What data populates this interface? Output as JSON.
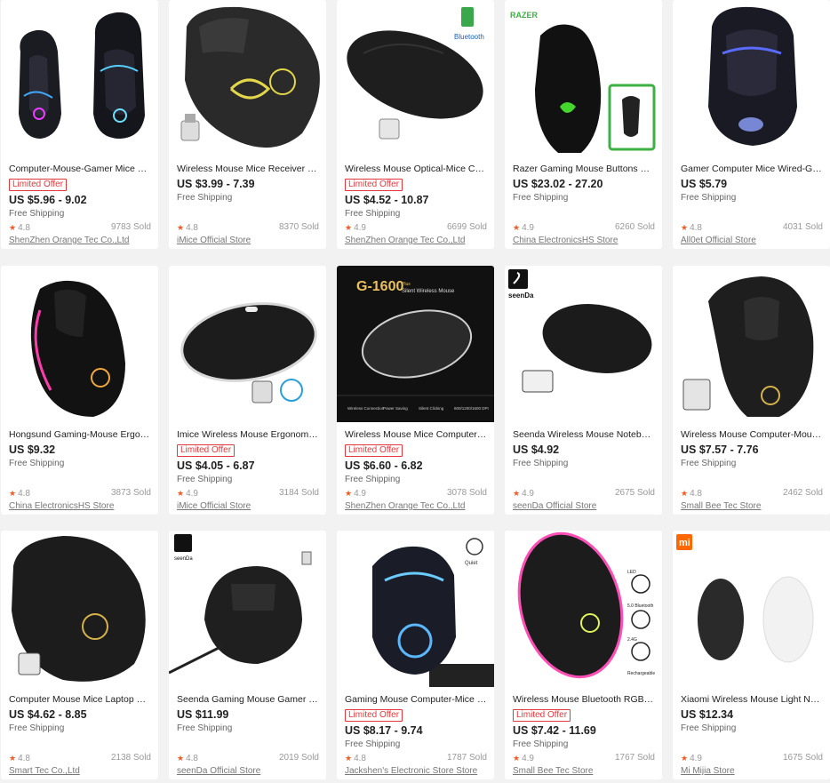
{
  "products": [
    {
      "title": "Computer-Mouse-Gamer Mice Ergonomic",
      "badge": "Limited Offer",
      "price": "US $5.96 - 9.02",
      "shipping": "Free Shipping",
      "rating": "4.8",
      "sold": "9783 Sold",
      "store": "ShenZhen Orange Tec Co.,Ltd",
      "image": "mouse-pair-rgb-icon"
    },
    {
      "title": "Wireless Mouse Mice Receiver Ergonomic",
      "badge": "",
      "price": "US $3.99 - 7.39",
      "shipping": "Free Shipping",
      "rating": "4.8",
      "sold": "8370 Sold",
      "store": "iMice Official Store",
      "image": "ergonomic-wireless-mouse-icon"
    },
    {
      "title": "Wireless Mouse Optical-Mice Computer",
      "badge": "Limited Offer",
      "price": "US $4.52 - 10.87",
      "shipping": "Free Shipping",
      "rating": "4.9",
      "sold": "6699 Sold",
      "store": "ShenZhen Orange Tec Co.,Ltd",
      "image": "slim-wireless-mouse-icon"
    },
    {
      "title": "Razer Gaming Mouse Buttons Mice",
      "badge": "",
      "price": "US $23.02 - 27.20",
      "shipping": "Free Shipping",
      "rating": "4.9",
      "sold": "6260 Sold",
      "store": "China ElectronicsHS Store",
      "image": "razer-mouse-icon"
    },
    {
      "title": "Gamer Computer Mice Wired-Gaming",
      "badge": "",
      "price": "US $5.79",
      "shipping": "Free Shipping",
      "rating": "4.8",
      "sold": "4031 Sold",
      "store": "All0et Official Store",
      "image": "gamer-mouse-icon"
    },
    {
      "title": "Hongsund Gaming-Mouse Ergonomic",
      "badge": "",
      "price": "US $9.32",
      "shipping": "Free Shipping",
      "rating": "4.8",
      "sold": "3873 Sold",
      "store": "China ElectronicsHS Store",
      "image": "gaming-mouse-rgb-icon"
    },
    {
      "title": "Imice Wireless Mouse Ergonomic Laptop",
      "badge": "Limited Offer",
      "price": "US $4.05 - 6.87",
      "shipping": "Free Shipping",
      "rating": "4.9",
      "sold": "3184 Sold",
      "store": "iMice Official Store",
      "image": "silent-wireless-mouse-icon"
    },
    {
      "title": "Wireless Mouse Mice Computer Laptop",
      "badge": "Limited Offer",
      "price": "US $6.60 - 6.82",
      "shipping": "Free Shipping",
      "rating": "4.9",
      "sold": "3078 Sold",
      "store": "ShenZhen Orange Tec Co.,Ltd",
      "image": "g1600-mouse-icon",
      "banner": "G-1600",
      "banner_sub": "Silent Wireless Mouse",
      "banner_plus": "Plus",
      "feat": [
        "Wireless Connection",
        "Power Saving",
        "Silent Clicking",
        "800/1200/1600 DPI"
      ]
    },
    {
      "title": "Seenda Wireless Mouse Notebook Mice",
      "badge": "",
      "price": "US $4.92",
      "shipping": "Free Shipping",
      "rating": "4.9",
      "sold": "2675 Sold",
      "store": "seenDa Official Store",
      "image": "seenda-mouse-icon",
      "brand": "seenDa"
    },
    {
      "title": "Wireless Mouse Computer-Mouse-Ergonomic",
      "badge": "",
      "price": "US $7.57 - 7.76",
      "shipping": "Free Shipping",
      "rating": "4.8",
      "sold": "2462 Sold",
      "store": "Small Bee Tec Store",
      "image": "vertical-mouse-icon"
    },
    {
      "title": "Computer Mouse Mice Laptop Ghz Wireless",
      "badge": "",
      "price": "US $4.62 - 8.85",
      "shipping": "Free Shipping",
      "rating": "4.8",
      "sold": "2138 Sold",
      "store": "Smart Tec Co.,Ltd",
      "image": "ergonomic-mouse-icon"
    },
    {
      "title": "Seenda Gaming Mouse Gamer Laptop",
      "badge": "",
      "price": "US $11.99",
      "shipping": "Free Shipping",
      "rating": "4.8",
      "sold": "2019 Sold",
      "store": "seenDa Official Store",
      "image": "seenda-gaming-mouse-icon",
      "brand": "seenDa"
    },
    {
      "title": "Gaming Mouse Computer-Mice Wired",
      "badge": "Limited Offer",
      "price": "US $8.17 - 9.74",
      "shipping": "Free Shipping",
      "rating": "4.8",
      "sold": "1787 Sold",
      "store": "Jackshen's Electronic Store Store",
      "image": "quiet-gaming-mouse-icon",
      "quiet": "Quiet"
    },
    {
      "title": "Wireless Mouse Bluetooth RGB Rechargeable",
      "badge": "Limited Offer",
      "price": "US $7.42 - 11.69",
      "shipping": "Free Shipping",
      "rating": "4.9",
      "sold": "1767 Sold",
      "store": "Small Bee Tec Store",
      "image": "rgb-bluetooth-mouse-icon",
      "feat": [
        "LED",
        "5.0 Bluetooth",
        "2.4G",
        "Rechargeable"
      ]
    },
    {
      "title": "Xiaomi Wireless Mouse Light Notebook",
      "badge": "",
      "price": "US $12.34",
      "shipping": "Free Shipping",
      "rating": "4.9",
      "sold": "1675 Sold",
      "store": "Mi Mijia Store",
      "image": "xiaomi-mouse-icon",
      "brand": "mi"
    }
  ],
  "colors": {
    "accent": "#e4393c",
    "star": "#f15a24",
    "text": "#222222",
    "muted": "#999999",
    "background": "#f2f2f2"
  }
}
